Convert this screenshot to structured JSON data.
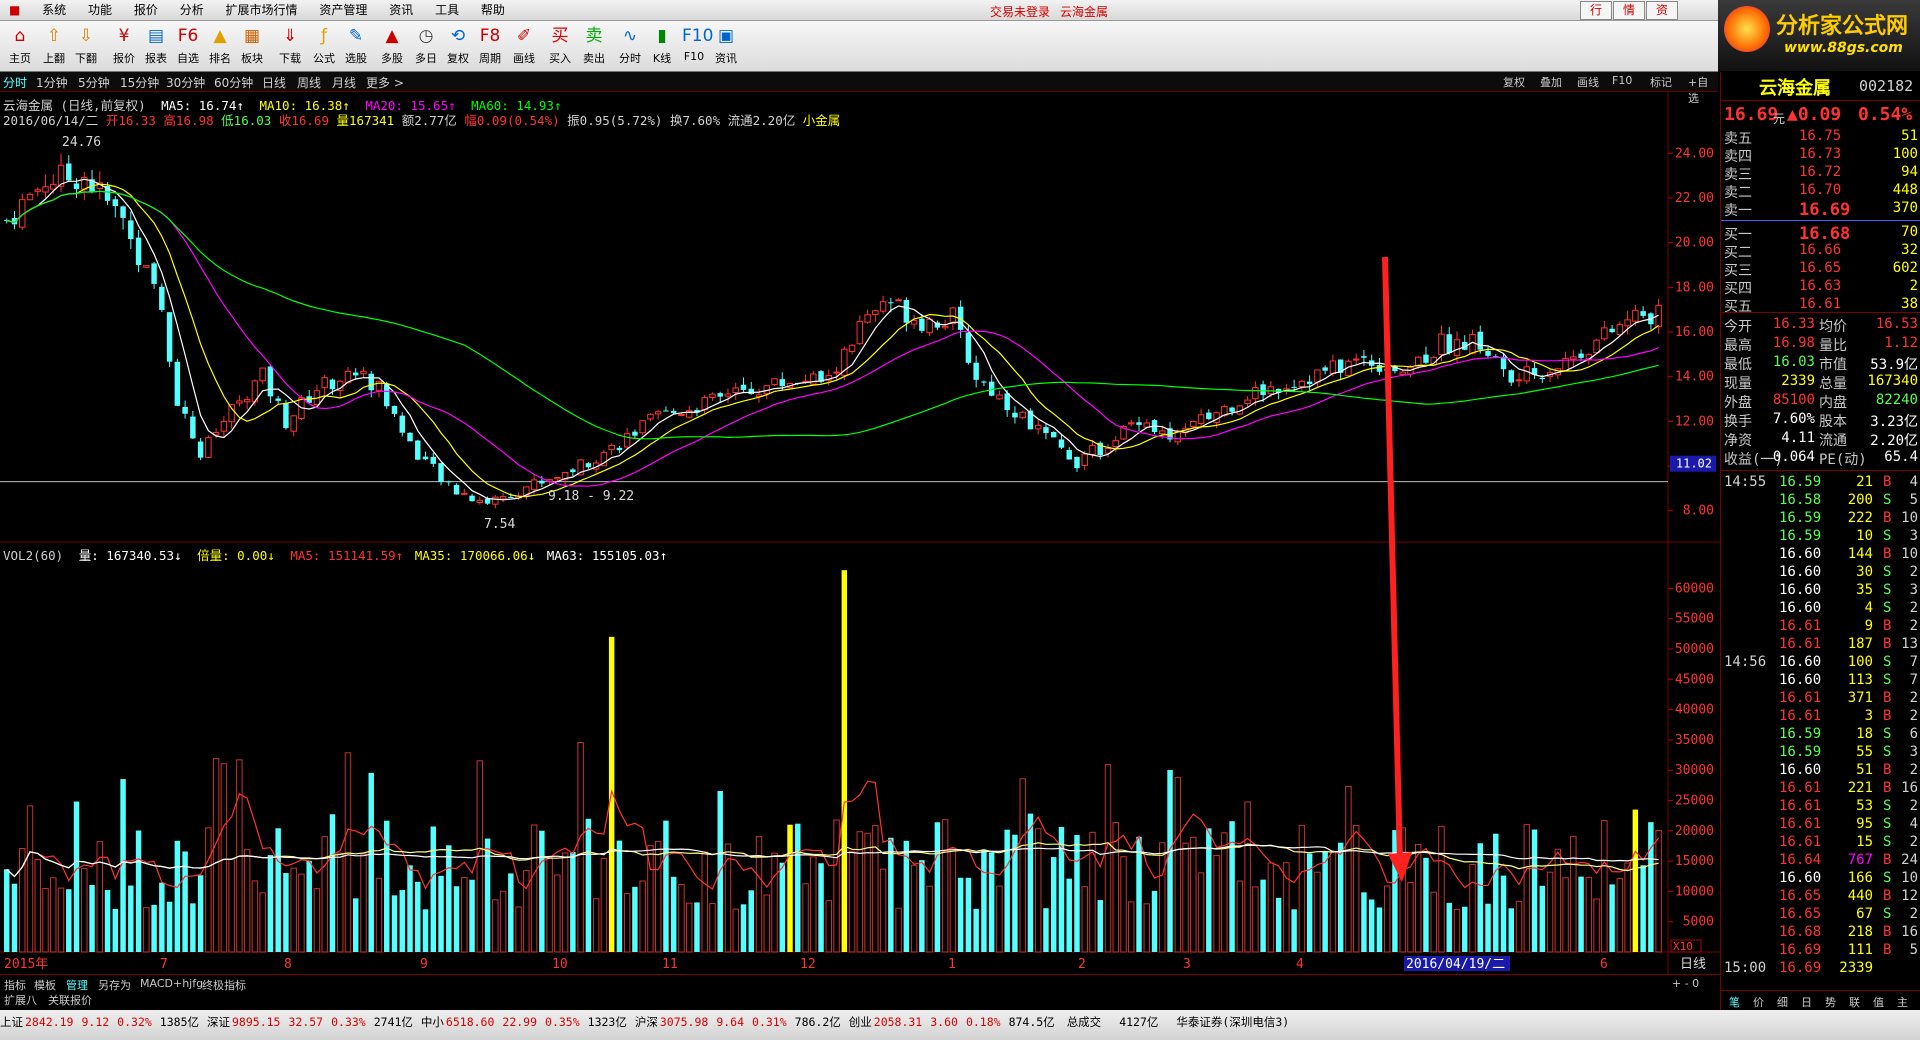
{
  "menu": {
    "items": [
      "系统",
      "功能",
      "报价",
      "分析",
      "扩展市场行情",
      "资产管理",
      "资讯",
      "工具",
      "帮助"
    ],
    "center_status": "交易未登录",
    "center_stock": "云海金属",
    "right_buttons": [
      "行",
      "情",
      "资"
    ]
  },
  "logo": {
    "title": "分析家公式网",
    "url": "www.88gs.com"
  },
  "toolbar": [
    "主页",
    "上翻",
    "下翻",
    "报价",
    "报表",
    "自选",
    "排名",
    "板块",
    "下载",
    "公式",
    "选股",
    "多股",
    "多日",
    "复权",
    "周期",
    "画线",
    "买入",
    "卖出",
    "分时",
    "K线",
    "F10",
    "资讯"
  ],
  "period_tabs": [
    "分时",
    "1分钟",
    "5分钟",
    "15分钟",
    "30分钟",
    "60分钟",
    "日线",
    "周线",
    "月线",
    "更多 >"
  ],
  "right_tabs": [
    "复权",
    "叠加",
    "画线",
    "F10",
    "标记",
    "+自选"
  ],
  "header_line1": {
    "name": "云海金属 (日线,前复权)",
    "ma5": "MA5: 16.74↑",
    "ma10": "MA10: 16.38↑",
    "ma20": "MA20: 15.65↑",
    "ma60": "MA60: 14.93↑"
  },
  "header_line2": {
    "date": "2016/06/14/二",
    "open": "开16.33",
    "high": "高16.98",
    "low": "低16.03",
    "close": "收16.69",
    "vol": "量167341",
    "amt": "额2.77亿",
    "chg": "幅0.09(0.54%)",
    "rest": "振0.95(5.72%) 换7.60% 流通2.20亿",
    "sector": "小金属"
  },
  "vol_line": {
    "name": "VOL2(60)",
    "vol": "量: 167340.53↓",
    "bl": "倍量: 0.00↓",
    "ma5": "MA5: 151141.59↑",
    "ma35": "MA35: 170066.06↓",
    "ma63": "MA63: 155105.03↑"
  },
  "chart_data": {
    "type": "candlestick",
    "price_axis": {
      "ticks": [
        "24.00",
        "22.00",
        "20.00",
        "18.00",
        "16.00",
        "14.00",
        "12.00",
        "10.00",
        "8.00"
      ],
      "ylim": [
        6.6,
        25.4
      ],
      "current_label": "11.02"
    },
    "volume_axis": {
      "ticks": [
        "60000",
        "55000",
        "50000",
        "45000",
        "40000",
        "35000",
        "30000",
        "25000",
        "20000",
        "15000",
        "10000",
        "5000"
      ],
      "ylim": [
        0,
        66000
      ],
      "scale": "X10"
    },
    "annotations": {
      "high": "24.76",
      "low": "7.54",
      "range": "9.18 - 9.22"
    },
    "x_labels": [
      "2015年",
      "7",
      "8",
      "9",
      "10",
      "11",
      "12",
      "1",
      "2",
      "3",
      "4",
      "2016/04/19/二",
      "6"
    ],
    "indicator_label": "日线",
    "price_line": [
      [
        0,
        21.0
      ],
      [
        5,
        22.8
      ],
      [
        10,
        23.0
      ],
      [
        15,
        21.0
      ],
      [
        20,
        17.0
      ],
      [
        22,
        13.0
      ],
      [
        25,
        10.5
      ],
      [
        30,
        13.0
      ],
      [
        33,
        14.0
      ],
      [
        36,
        12.0
      ],
      [
        40,
        13.5
      ],
      [
        45,
        14.2
      ],
      [
        48,
        13.5
      ],
      [
        52,
        11.0
      ],
      [
        57,
        9.0
      ],
      [
        62,
        8.4
      ],
      [
        67,
        9.1
      ],
      [
        72,
        9.7
      ],
      [
        78,
        10.8
      ],
      [
        84,
        12.2
      ],
      [
        90,
        12.8
      ],
      [
        96,
        13.4
      ],
      [
        102,
        13.9
      ],
      [
        106,
        13.8
      ],
      [
        110,
        16.2
      ],
      [
        114,
        17.3
      ],
      [
        118,
        16.5
      ],
      [
        122,
        16.6
      ],
      [
        125,
        14.0
      ],
      [
        130,
        12.5
      ],
      [
        135,
        11.0
      ],
      [
        138,
        10.2
      ],
      [
        142,
        11.0
      ],
      [
        146,
        12.2
      ],
      [
        150,
        11.2
      ],
      [
        155,
        12.2
      ],
      [
        160,
        13.2
      ],
      [
        168,
        14.0
      ],
      [
        175,
        14.8
      ],
      [
        180,
        14.3
      ],
      [
        185,
        15.5
      ],
      [
        190,
        15.5
      ],
      [
        194,
        13.8
      ],
      [
        200,
        14.5
      ],
      [
        206,
        15.8
      ],
      [
        210,
        16.7
      ]
    ],
    "volume_bars_note": "approximate daily volume (x10), yellow = marked bars",
    "volume_highlights": [
      [
        78,
        52000
      ],
      [
        101,
        21000
      ],
      [
        108,
        63000
      ],
      [
        210,
        23500
      ]
    ]
  },
  "quote": {
    "name": "云海金属",
    "code": "002182",
    "price": "16.69",
    "unit": "元",
    "chg": "▲0.09",
    "pct": "0.54%",
    "asks": [
      [
        "卖五",
        "16.75",
        "51"
      ],
      [
        "卖四",
        "16.73",
        "100"
      ],
      [
        "卖三",
        "16.72",
        "94"
      ],
      [
        "卖二",
        "16.70",
        "448"
      ],
      [
        "卖一",
        "16.69",
        "370"
      ]
    ],
    "bids": [
      [
        "买一",
        "16.68",
        "70"
      ],
      [
        "买二",
        "16.66",
        "32"
      ],
      [
        "买三",
        "16.65",
        "602"
      ],
      [
        "买四",
        "16.63",
        "2"
      ],
      [
        "买五",
        "16.61",
        "38"
      ]
    ],
    "stats": [
      [
        "今开",
        "16.33",
        "均价",
        "16.53"
      ],
      [
        "最高",
        "16.98",
        "量比",
        "1.12"
      ],
      [
        "最低",
        "16.03",
        "市值",
        "53.9亿"
      ],
      [
        "现量",
        "2339",
        "总量",
        "167340"
      ],
      [
        "外盘",
        "85100",
        "内盘",
        "82240"
      ],
      [
        "换手",
        "7.60%",
        "股本",
        "3.23亿"
      ],
      [
        "净资",
        "4.11",
        "流通",
        "2.20亿"
      ],
      [
        "收益(一)",
        "0.064",
        "PE(动)",
        "65.4"
      ]
    ],
    "ticks": [
      [
        "14:55",
        "16.59",
        "21",
        "B",
        "4"
      ],
      [
        "",
        "16.58",
        "200",
        "S",
        "5"
      ],
      [
        "",
        "16.59",
        "222",
        "B",
        "10"
      ],
      [
        "",
        "16.59",
        "10",
        "S",
        "3"
      ],
      [
        "",
        "16.60",
        "144",
        "B",
        "10"
      ],
      [
        "",
        "16.60",
        "30",
        "S",
        "2"
      ],
      [
        "",
        "16.60",
        "35",
        "S",
        "3"
      ],
      [
        "",
        "16.60",
        "4",
        "S",
        "2"
      ],
      [
        "",
        "16.61",
        "9",
        "B",
        "2"
      ],
      [
        "",
        "16.61",
        "187",
        "B",
        "13"
      ],
      [
        "14:56",
        "16.60",
        "100",
        "S",
        "7"
      ],
      [
        "",
        "16.60",
        "113",
        "S",
        "7"
      ],
      [
        "",
        "16.61",
        "371",
        "B",
        "2"
      ],
      [
        "",
        "16.61",
        "3",
        "B",
        "2"
      ],
      [
        "",
        "16.59",
        "18",
        "S",
        "6"
      ],
      [
        "",
        "16.59",
        "55",
        "S",
        "3"
      ],
      [
        "",
        "16.60",
        "51",
        "B",
        "2"
      ],
      [
        "",
        "16.61",
        "221",
        "B",
        "16"
      ],
      [
        "",
        "16.61",
        "53",
        "S",
        "2"
      ],
      [
        "",
        "16.61",
        "95",
        "S",
        "4"
      ],
      [
        "",
        "16.61",
        "15",
        "S",
        "2"
      ],
      [
        "",
        "16.64",
        "767",
        "B",
        "24"
      ],
      [
        "",
        "16.60",
        "166",
        "S",
        "10"
      ],
      [
        "",
        "16.65",
        "440",
        "B",
        "12"
      ],
      [
        "",
        "16.65",
        "67",
        "S",
        "2"
      ],
      [
        "",
        "16.68",
        "218",
        "B",
        "16"
      ],
      [
        "",
        "16.69",
        "111",
        "B",
        "5"
      ],
      [
        "15:00",
        "16.69",
        "2339",
        "",
        ""
      ]
    ],
    "bottom_tabs": [
      "笔",
      "价",
      "细",
      "日",
      "势",
      "联",
      "值",
      "主"
    ]
  },
  "bottom_tabs": [
    "指标",
    "模板",
    "管理",
    "另存为",
    "MACD+hjfg",
    "终极指标"
  ],
  "bottom_tabs2": [
    "扩展八",
    "关联报价"
  ],
  "status": {
    "items": [
      [
        "上证",
        "2842.19",
        "9.12",
        "0.32%",
        "1385亿"
      ],
      [
        "深证",
        "9895.15",
        "32.57",
        "0.33%",
        "2741亿"
      ],
      [
        "中小",
        "6518.60",
        "22.99",
        "0.35%",
        "1323亿"
      ],
      [
        "沪深",
        "3075.98",
        "9.64",
        "0.31%",
        "786.2亿"
      ],
      [
        "创业",
        "2058.31",
        "3.60",
        "0.18%",
        "874.5亿"
      ]
    ],
    "total_label": "总成交",
    "total": "4127亿",
    "broker": "华泰证券(深圳电信3)"
  },
  "colors": {
    "up": "#ff3232",
    "down": "#54ffff",
    "ma5": "#ffffff",
    "ma10": "#ffff00",
    "ma20": "#ff00ff",
    "ma60": "#00ff00",
    "grid": "#7a0000"
  }
}
